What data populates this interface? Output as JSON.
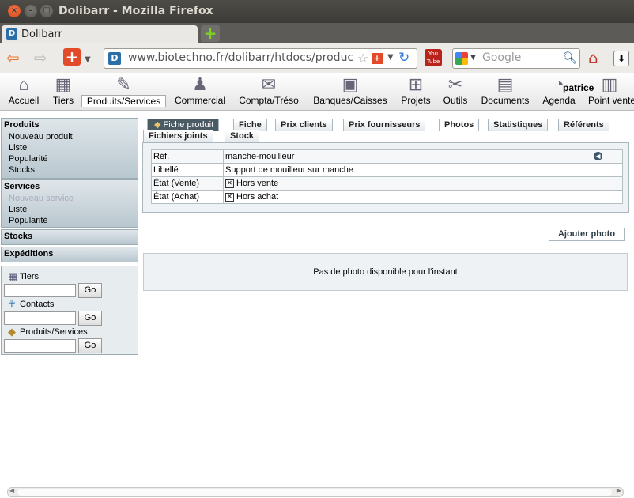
{
  "window": {
    "title": "Dolibarr - Mozilla Firefox"
  },
  "browser": {
    "tab_label": "Dolibarr",
    "url": "www.biotechno.fr/dolibarr/htdocs/product",
    "search_placeholder": "Google"
  },
  "menu": {
    "items": [
      {
        "label": "Accueil",
        "icon": "home-icon"
      },
      {
        "label": "Tiers",
        "icon": "company-icon"
      },
      {
        "label": "Produits/Services",
        "icon": "product-icon"
      },
      {
        "label": "Commercial",
        "icon": "commercial-icon"
      },
      {
        "label": "Compta/Tréso",
        "icon": "accounting-icon"
      },
      {
        "label": "Banques/Caisses",
        "icon": "bank-icon"
      },
      {
        "label": "Projets",
        "icon": "project-icon"
      },
      {
        "label": "Outils",
        "icon": "tools-icon"
      },
      {
        "label": "Documents",
        "icon": "documents-icon"
      },
      {
        "label": "Agenda",
        "icon": "agenda-icon"
      },
      {
        "label": "Point vente",
        "icon": "cashdesk-icon"
      }
    ],
    "user": "patrice"
  },
  "sidebar": {
    "produits": {
      "title": "Produits",
      "items": [
        "Nouveau produit",
        "Liste",
        "Popularité",
        "Stocks"
      ]
    },
    "services": {
      "title": "Services",
      "items": [
        "Nouveau service",
        "Liste",
        "Popularité"
      ]
    },
    "stocks": "Stocks",
    "expeditions": "Expéditions",
    "search": {
      "tiers": "Tiers",
      "contacts": "Contacts",
      "produits": "Produits/Services",
      "go": "Go"
    }
  },
  "tabs": {
    "header": "Fiche produit",
    "row1": [
      "Fiche",
      "Prix clients",
      "Prix fournisseurs",
      "Photos",
      "Statistiques",
      "Référents"
    ],
    "row2": [
      "Fichiers joints",
      "Stock"
    ]
  },
  "product": {
    "ref_label": "Réf.",
    "ref": "manche-mouilleur",
    "libelle_label": "Libellé",
    "libelle": "Support de mouilleur sur manche",
    "etat_vente_label": "État (Vente)",
    "etat_vente": "Hors vente",
    "etat_achat_label": "État (Achat)",
    "etat_achat": "Hors achat"
  },
  "photos": {
    "add_button": "Ajouter photo",
    "empty": "Pas de photo disponible pour l'instant"
  }
}
